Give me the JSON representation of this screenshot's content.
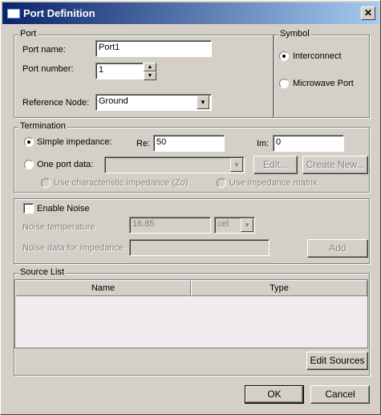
{
  "window": {
    "title": "Port Definition",
    "close_symbol": "✕"
  },
  "port": {
    "legend": "Port",
    "name_label": "Port name:",
    "name_value": "Port1",
    "number_label": "Port number:",
    "number_value": "1",
    "ref_label": "Reference Node:",
    "ref_value": "Ground"
  },
  "symbol": {
    "legend": "Symbol",
    "options": [
      "Interconnect",
      "Microwave Port"
    ],
    "selected": "Interconnect"
  },
  "termination": {
    "legend": "Termination",
    "simple_label": "Simple impedance:",
    "re_label": "Re:",
    "re_value": "50",
    "im_label": "Im:",
    "im_value": "0",
    "one_port_label": "One port data:",
    "one_port_value": "",
    "edit_label": "Edit...",
    "create_label": "Create New...",
    "char_imp_label": "Use characteristic impedance (Zo)",
    "imp_matrix_label": "Use impedance matrix",
    "selected": "Simple impedance"
  },
  "noise": {
    "enable_label": "Enable Noise",
    "enabled": false,
    "temp_label": "Noise temperature",
    "temp_value": "16.85",
    "unit_value": "cel",
    "data_label": "Noise data for Impedance",
    "data_value": "",
    "add_label": "Add"
  },
  "source": {
    "legend": "Source List",
    "columns": [
      "Name",
      "Type"
    ],
    "rows": [],
    "edit_label": "Edit Sources"
  },
  "footer": {
    "ok_label": "OK",
    "cancel_label": "Cancel"
  },
  "icons": {
    "dropdown": "▼",
    "spin_up": "▲",
    "spin_down": "▼"
  }
}
